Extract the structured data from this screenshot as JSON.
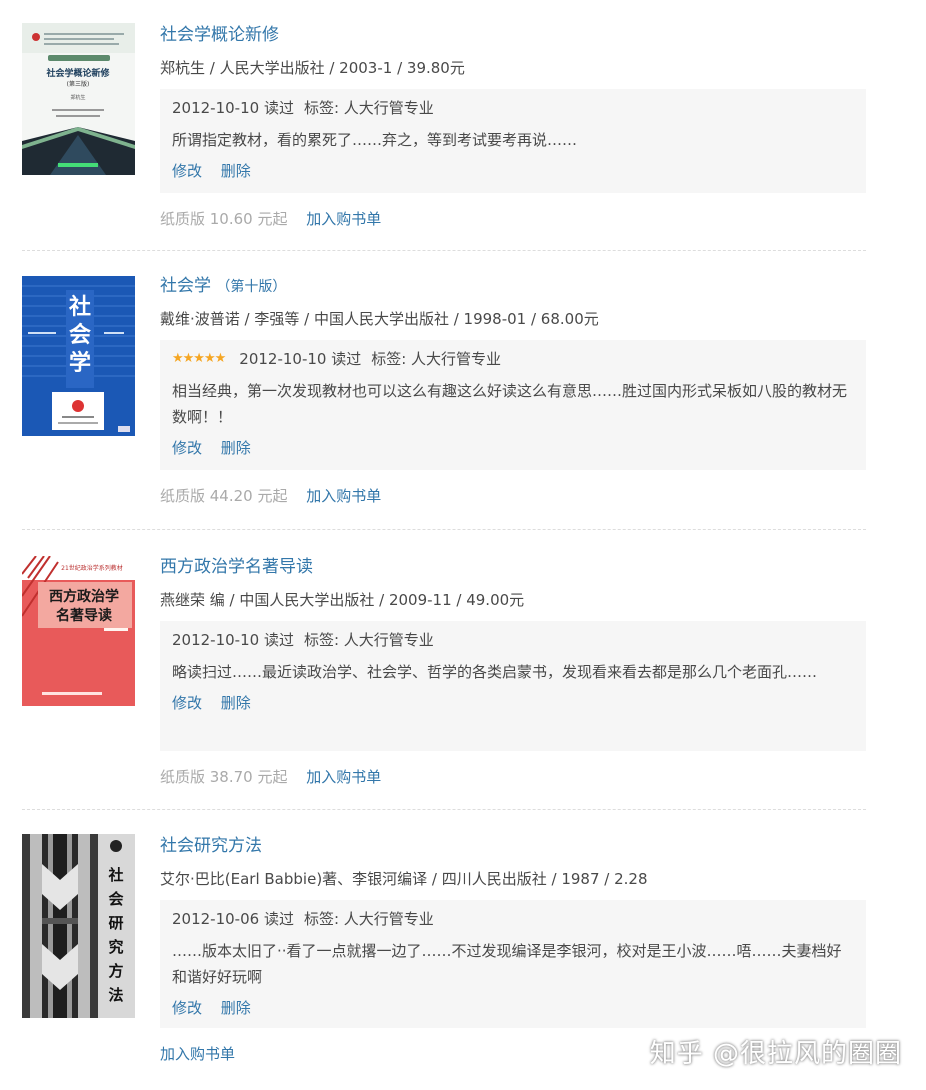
{
  "books": [
    {
      "title": "社会学概论新修",
      "subtitle": "",
      "pub_info": "郑杭生 / 人民大学出版社 / 2003-1 / 39.80元",
      "rating": "",
      "date_read": "2012-10-10 读过",
      "tags": "标签: 人大行管专业",
      "comment": "所谓指定教材，看的累死了……弃之，等到考试要考再说……",
      "edit_label": "修改",
      "delete_label": "删除",
      "paper_price": "纸质版 10.60 元起",
      "cart_label": "加入购书单",
      "cover": {
        "title": "社会学概论新修",
        "edition": "(第三版)",
        "author": "郑杭生"
      }
    },
    {
      "title": "社会学",
      "subtitle": "（第十版）",
      "pub_info": "戴维·波普诺 / 李强等 / 中国人民大学出版社 / 1998-01 / 68.00元",
      "rating": "★★★★★",
      "date_read": "2012-10-10 读过",
      "tags": "标签: 人大行管专业",
      "comment": "相当经典，第一次发现教材也可以这么有趣这么好读这么有意思……胜过国内形式呆板如八股的教材无数啊！！",
      "edit_label": "修改",
      "delete_label": "删除",
      "paper_price": "纸质版 44.20 元起",
      "cart_label": "加入购书单",
      "cover": {
        "title": "社会学"
      }
    },
    {
      "title": "西方政治学名著导读",
      "subtitle": "",
      "pub_info": "燕继荣 编 / 中国人民大学出版社 / 2009-11 / 49.00元",
      "rating": "",
      "date_read": "2012-10-10 读过",
      "tags": "标签: 人大行管专业",
      "comment": "略读扫过……最近读政治学、社会学、哲学的各类启蒙书，发现看来看去都是那么几个老面孔……",
      "edit_label": "修改",
      "delete_label": "删除",
      "paper_price": "纸质版 38.70 元起",
      "cart_label": "加入购书单",
      "cover": {
        "line1": "西方政治学",
        "line2": "名著导读",
        "series": "21世纪政治学系列教材"
      }
    },
    {
      "title": "社会研究方法",
      "subtitle": "",
      "pub_info": "艾尔·巴比(Earl Babbie)著、李银河编译 / 四川人民出版社 / 1987 / 2.28",
      "rating": "",
      "date_read": "2012-10-06 读过",
      "tags": "标签: 人大行管专业",
      "comment": "……版本太旧了··看了一点就撂一边了……不过发现编译是李银河，校对是王小波……唔……夫妻档好和谐好好玩啊",
      "edit_label": "修改",
      "delete_label": "删除",
      "paper_price": "",
      "cart_label": "加入购书单",
      "cover": {
        "title": "社会研究方法"
      }
    }
  ],
  "watermark": "知乎 @很拉风的圈圈",
  "colors": {
    "link": "#3377aa",
    "text": "#494949",
    "muted": "#aaaaaa",
    "box": "#f6f6f6",
    "star": "#f5a623"
  }
}
